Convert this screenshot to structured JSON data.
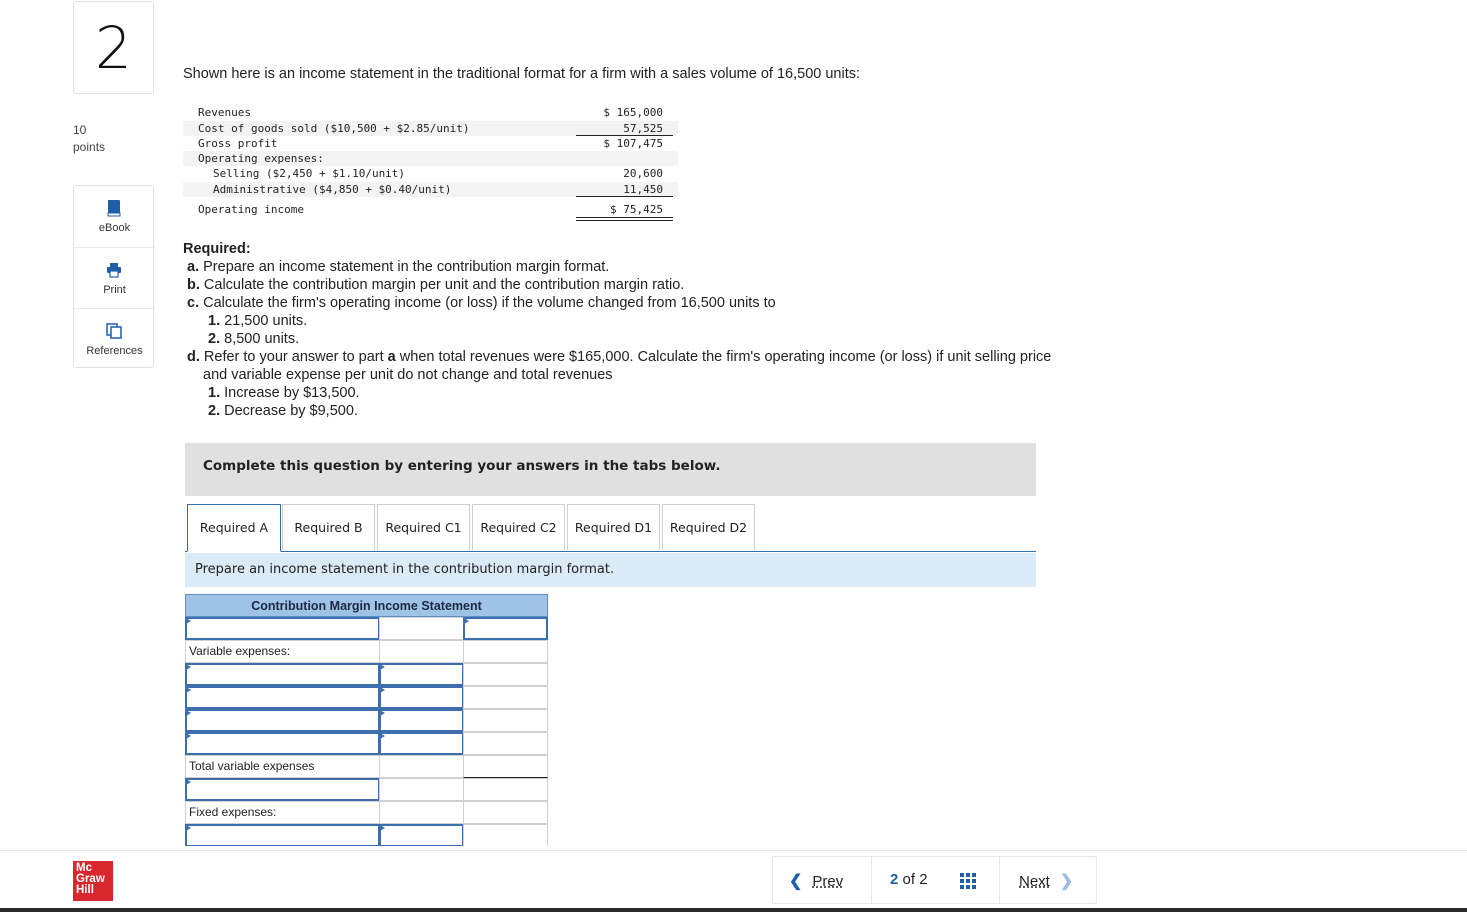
{
  "question": {
    "number": "2",
    "points_value": "10",
    "points_label": "points"
  },
  "tools": [
    {
      "label": "eBook",
      "icon": "book-icon"
    },
    {
      "label": "Print",
      "icon": "printer-icon"
    },
    {
      "label": "References",
      "icon": "references-icon"
    }
  ],
  "intro": "Shown here is an income statement in the traditional format for a firm with a sales volume of 16,500 units:",
  "statement": {
    "revenues": {
      "label": "Revenues",
      "value": "$ 165,000"
    },
    "cogs": {
      "label": "Cost of goods sold ($10,500 + $2.85/unit)",
      "value": "57,525"
    },
    "gross_profit": {
      "label": "Gross profit",
      "value": "$ 107,475"
    },
    "opex": {
      "label": "Operating expenses:"
    },
    "selling": {
      "label": "Selling ($2,450 + $1.10/unit)",
      "value": "20,600"
    },
    "admin": {
      "label": "Administrative ($4,850 + $0.40/unit)",
      "value": "11,450"
    },
    "operating_income": {
      "label": "Operating income",
      "value": "$ 75,425"
    }
  },
  "required": {
    "heading": "Required:",
    "a_letter": "a.",
    "a": "Prepare an income statement in the contribution margin format.",
    "b_letter": "b.",
    "b": "Calculate the contribution margin per unit and the contribution margin ratio.",
    "c_letter": "c.",
    "c": "Calculate the firm's operating income (or loss) if the volume changed from 16,500 units to",
    "c1_num": "1.",
    "c1": "21,500 units.",
    "c2_num": "2.",
    "c2": "8,500 units.",
    "d_letter": "d.",
    "d_pre": "Refer to your answer to part ",
    "d_bold": "a",
    "d_post": " when total revenues were $165,000. Calculate the firm's operating income (or loss) if unit selling price",
    "d_line2": "and variable expense per unit do not change and total revenues",
    "d1_num": "1.",
    "d1": "Increase by $13,500.",
    "d2_num": "2.",
    "d2": "Decrease by $9,500."
  },
  "instruction": "Complete this question by entering your answers in the tabs below.",
  "tabs": [
    "Required A",
    "Required B",
    "Required C1",
    "Required C2",
    "Required D1",
    "Required D2"
  ],
  "active_tab": "Required A",
  "prompt": "Prepare an income statement in the contribution margin format.",
  "table": {
    "title": "Contribution Margin Income Statement",
    "variable_expenses": "Variable expenses:",
    "total_variable_expenses": "Total variable expenses",
    "fixed_expenses": "Fixed expenses:"
  },
  "footer": {
    "logo_lines": [
      "Mc",
      "Graw",
      "Hill"
    ],
    "prev": "Prev",
    "page_current": "2",
    "page_of": "of",
    "page_total": "2",
    "next": "Next"
  },
  "colors": {
    "accent": "#2d6fb3",
    "table_header": "#9fc2e7",
    "prompt_bg": "#dbeaf7",
    "logo": "#d9272e"
  }
}
